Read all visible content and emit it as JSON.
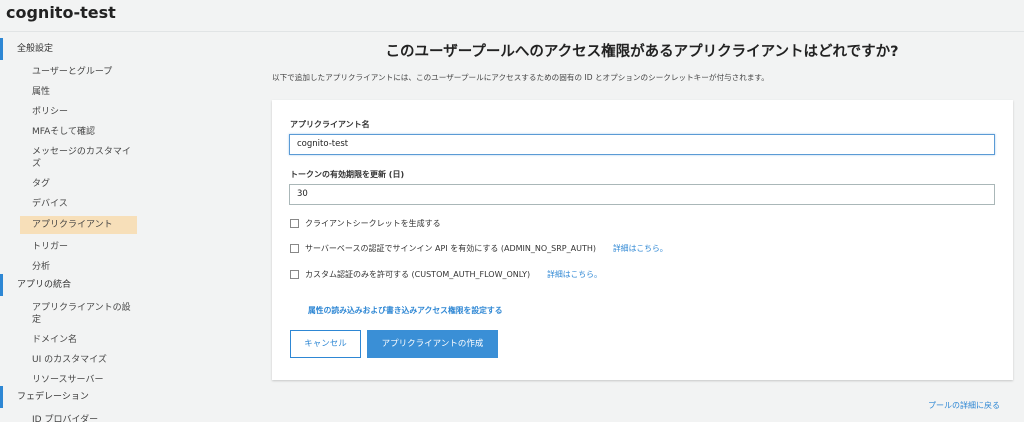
{
  "pool": {
    "title": "cognito-test"
  },
  "sidebar": {
    "sections": [
      {
        "label": "全般設定",
        "items": [
          {
            "label": "ユーザーとグループ"
          },
          {
            "label": "属性"
          },
          {
            "label": "ポリシー"
          },
          {
            "label": "MFAそして確認"
          },
          {
            "label": "メッセージのカスタマイズ"
          },
          {
            "label": "タグ"
          },
          {
            "label": "デバイス"
          },
          {
            "label": "アプリクライアント",
            "selected": true
          },
          {
            "label": "トリガー"
          },
          {
            "label": "分析"
          }
        ]
      },
      {
        "label": "アプリの統合",
        "items": [
          {
            "label": "アプリクライアントの設定"
          },
          {
            "label": "ドメイン名"
          },
          {
            "label": "UI のカスタマイズ"
          },
          {
            "label": "リソースサーバー"
          }
        ]
      },
      {
        "label": "フェデレーション",
        "items": [
          {
            "label": "ID プロバイダー"
          }
        ]
      }
    ]
  },
  "main": {
    "heading": "このユーザープールへのアクセス権限があるアプリクライアントはどれですか?",
    "description": "以下で追加したアプリクライアントには、このユーザープールにアクセスするための固有の ID とオプションのシークレットキーが付与されます。",
    "form": {
      "client_name_label": "アプリクライアント名",
      "client_name_value": "cognito-test",
      "token_label": "トークンの有効期限を更新 (日)",
      "token_value": "30",
      "checkboxes": [
        {
          "label": "クライアントシークレットを生成する",
          "checked": false,
          "link": ""
        },
        {
          "label": "サーバーベースの認証でサインイン API を有効にする (ADMIN_NO_SRP_AUTH)",
          "checked": false,
          "link": "詳細はこちら。"
        },
        {
          "label": "カスタム認証のみを許可する (CUSTOM_AUTH_FLOW_ONLY)",
          "checked": false,
          "link": "詳細はこちら。"
        }
      ],
      "attr_link": "属性の読み込みおよび書き込みアクセス権限を設定する",
      "cancel_label": "キャンセル",
      "create_label": "アプリクライアントの作成"
    },
    "back_link": "プールの詳細に戻る"
  },
  "colors": {
    "accent": "#2e87d4",
    "selected_bg": "#f7dfb9",
    "button_primary": "#3a8fd6"
  }
}
